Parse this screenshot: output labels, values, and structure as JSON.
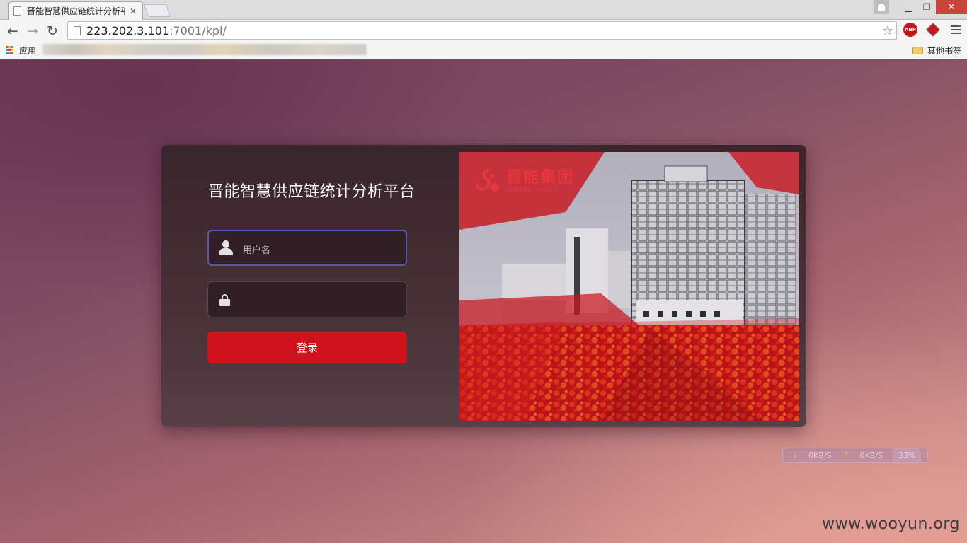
{
  "browser": {
    "tab_title": "晋能智慧供应链统计分析平",
    "url_host": "223.202.3.101",
    "url_rest": ":7001/kpi/",
    "extension_abp": "ABP",
    "bookmarks": {
      "apps_label": "应用",
      "other_label": "其他书签"
    }
  },
  "login": {
    "title": "晋能智慧供应链统计分析平台",
    "username_placeholder": "用户名",
    "submit_label": "登录"
  },
  "hero": {
    "logo_cn": "晋能集团",
    "logo_en": "JINNENG GROUP"
  },
  "netspeed": {
    "down": "0KB/S",
    "up": "0KB/S",
    "cpu": "33%"
  },
  "watermark": "www.wooyun.org",
  "colors": {
    "accent_red": "#cf121c",
    "focus_border": "#4b5fae",
    "card_bg": "#3a252c"
  },
  "icons": [
    "back-arrow-icon",
    "forward-arrow-icon",
    "reload-icon",
    "page-icon",
    "star-icon",
    "menu-icon",
    "apps-icon",
    "folder-icon",
    "user-icon",
    "lock-icon",
    "logo-mark-icon"
  ]
}
